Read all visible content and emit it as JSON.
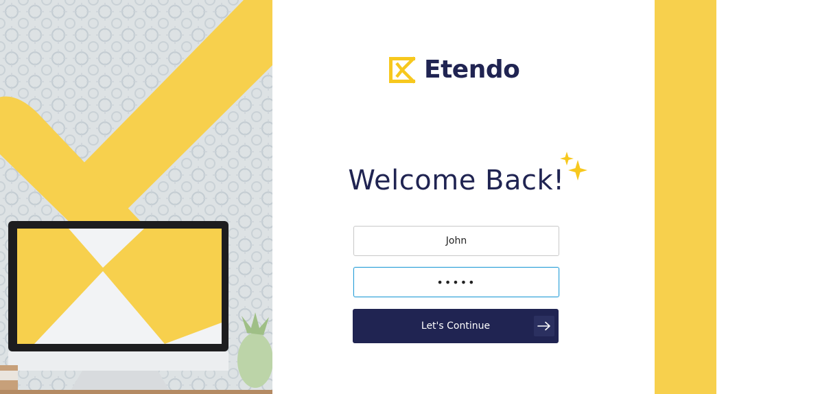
{
  "brand": {
    "name": "Etendo",
    "accent_color": "#f7d04d",
    "navy_color": "#202452"
  },
  "login": {
    "title": "Welcome Back!",
    "username_value": "John",
    "password_value": "•••••",
    "continue_label": "Let's Continue",
    "focus_color": "#2a9fd8"
  },
  "icons": {
    "logo": "etendo-logo-mark",
    "sparkle": "sparkle-icon",
    "arrow": "arrow-right-icon"
  }
}
